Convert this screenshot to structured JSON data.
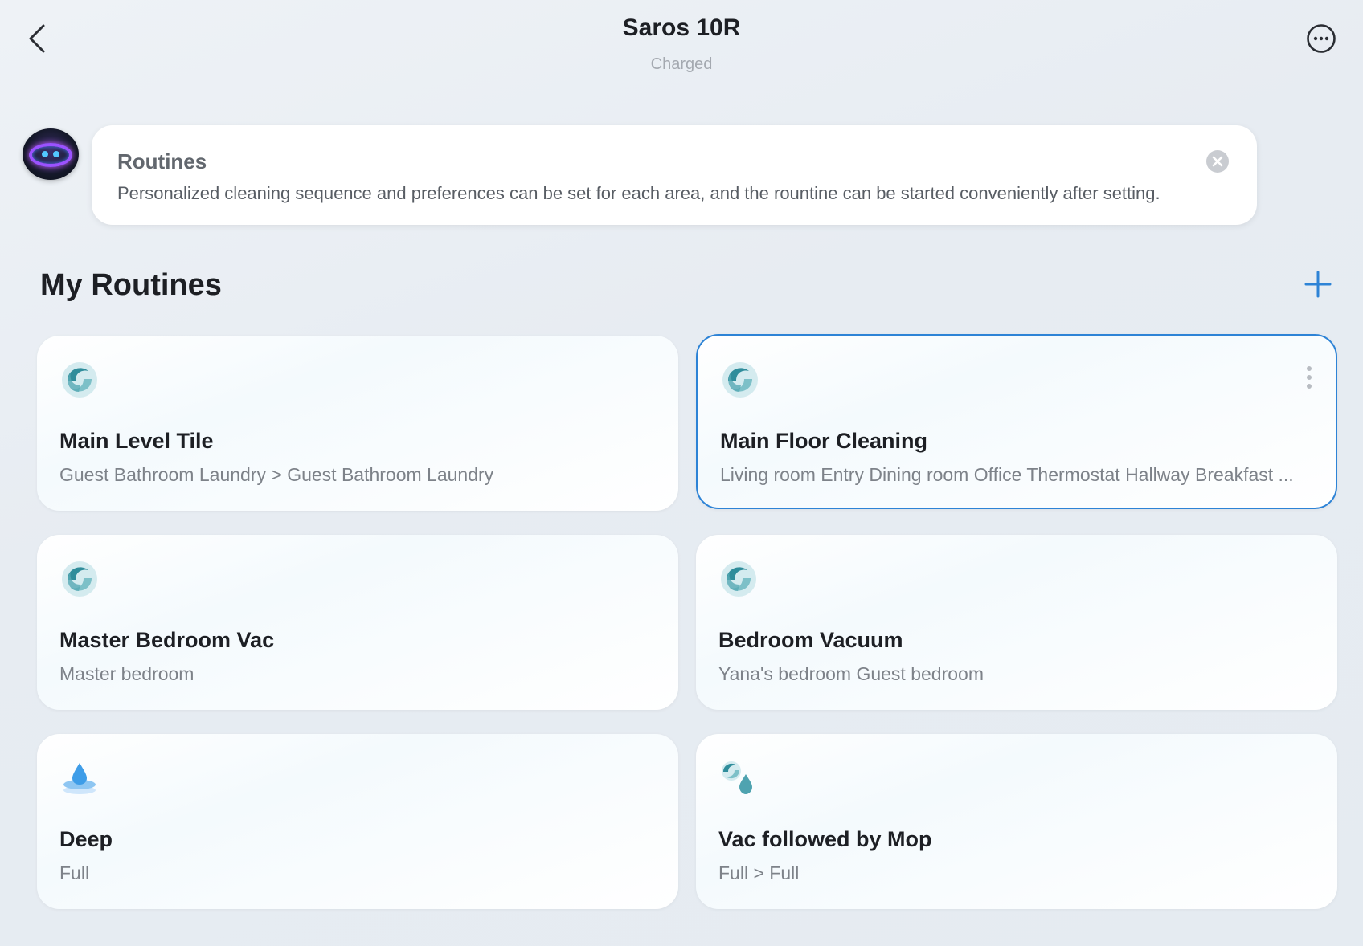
{
  "header": {
    "title": "Saros 10R",
    "status": "Charged"
  },
  "tip": {
    "title": "Routines",
    "text": "Personalized cleaning sequence and preferences can be set for each area, and the rountine can be started conveniently after setting."
  },
  "section": {
    "title": "My Routines"
  },
  "routines": [
    {
      "name": "Main Level Tile",
      "desc": "Guest Bathroom Laundry > Guest Bathroom Laundry",
      "icon": "vacuum-swirl-icon",
      "selected": false
    },
    {
      "name": "Main Floor Cleaning",
      "desc": "Living room Entry Dining room Office Thermostat Hallway Breakfast ...",
      "icon": "vacuum-swirl-icon",
      "selected": true
    },
    {
      "name": "Master Bedroom Vac",
      "desc": "Master bedroom",
      "icon": "vacuum-swirl-icon",
      "selected": false
    },
    {
      "name": "Bedroom Vacuum",
      "desc": "Yana's bedroom Guest bedroom",
      "icon": "vacuum-swirl-icon",
      "selected": false
    },
    {
      "name": "Deep",
      "desc": "Full",
      "icon": "mop-drop-icon",
      "selected": false
    },
    {
      "name": "Vac followed by Mop",
      "desc": "Full > Full",
      "icon": "vacuum-then-mop-icon",
      "selected": false
    }
  ],
  "colors": {
    "accent": "#2d83d6",
    "swirl": "#4fa3b0"
  }
}
